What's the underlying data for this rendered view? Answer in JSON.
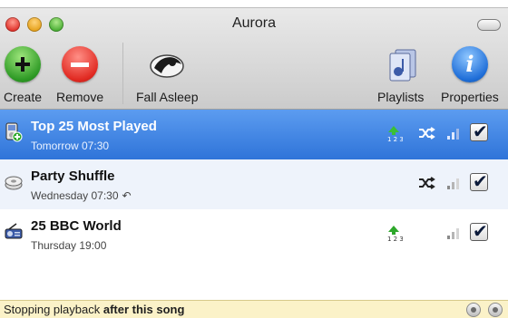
{
  "window": {
    "title": "Aurora"
  },
  "toolbar": {
    "create_label": "Create",
    "remove_label": "Remove",
    "fall_asleep_label": "Fall Asleep",
    "playlists_label": "Playlists",
    "properties_label": "Properties",
    "properties_glyph": "i"
  },
  "alarms": [
    {
      "name": "Top 25 Most Played",
      "when": "Tomorrow 07:30",
      "selected": true,
      "enabled": true,
      "volume_ramp": true,
      "shuffle": true,
      "repeat": false,
      "icon": "ipod-playlist-icon"
    },
    {
      "name": "Party Shuffle",
      "when": "Wednesday 07:30",
      "selected": false,
      "enabled": true,
      "volume_ramp": false,
      "shuffle": true,
      "repeat": true,
      "icon": "party-shuffle-icon"
    },
    {
      "name": "25 BBC World",
      "when": "Thursday 19:00",
      "selected": false,
      "enabled": true,
      "volume_ramp": true,
      "shuffle": false,
      "repeat": false,
      "icon": "radio-stream-icon"
    }
  ],
  "statusbar": {
    "text_prefix": "Stopping playback",
    "text_bold": "after this song"
  },
  "colors": {
    "selection": "#2f74d9",
    "status_bg": "#fbf2c8"
  }
}
